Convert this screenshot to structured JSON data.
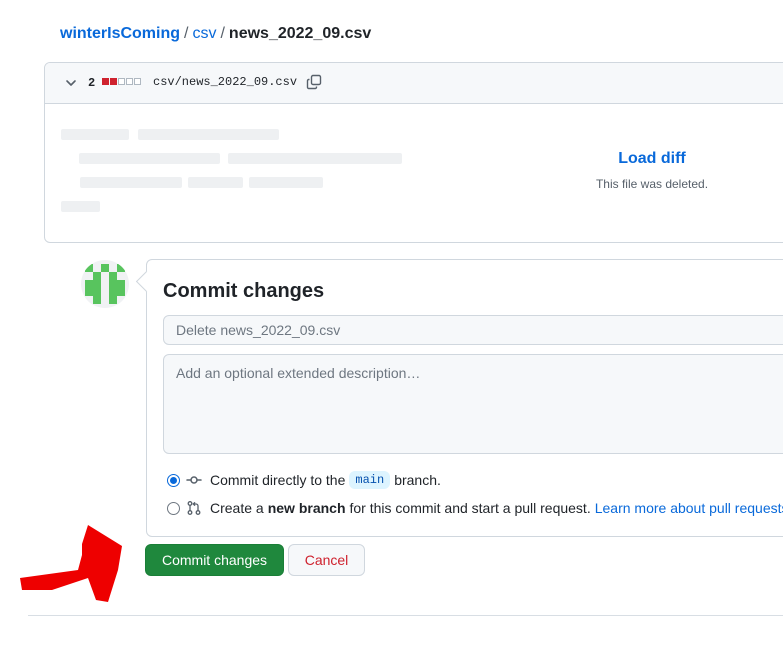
{
  "breadcrumb": {
    "owner": "winterIsComing",
    "separator": "/",
    "folder": "csv",
    "file": "news_2022_09.csv"
  },
  "diff": {
    "change_count": "2",
    "diffstat": [
      "deleted",
      "deleted",
      "neutral",
      "neutral",
      "neutral"
    ],
    "path": "csv/news_2022_09.csv",
    "load_diff_label": "Load diff",
    "deleted_note": "This file was deleted."
  },
  "commit": {
    "title": "Commit changes",
    "summary_placeholder": "Delete news_2022_09.csv",
    "description_placeholder": "Add an optional extended description…",
    "option_direct": {
      "prefix": "Commit directly to the",
      "branch": "main",
      "suffix": "branch.",
      "selected": true
    },
    "option_new_branch": {
      "prefix": "Create a",
      "bold": "new branch",
      "suffix": "for this commit and start a pull request.",
      "link": "Learn more about pull requests",
      "selected": false
    },
    "submit_label": "Commit changes",
    "cancel_label": "Cancel"
  },
  "colors": {
    "link": "#0969da",
    "primary_button": "#1f883d",
    "danger": "#cf222e",
    "annotation_arrow": "#ee0000"
  }
}
